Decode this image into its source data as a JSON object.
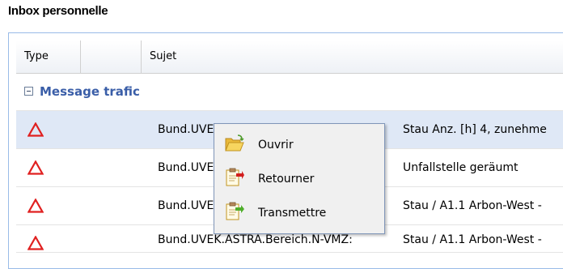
{
  "panel": {
    "title": "Inbox personnelle"
  },
  "grid": {
    "columns": [
      "Type",
      "",
      "Sujet"
    ],
    "group": {
      "label": "Message trafic",
      "state": "expanded"
    },
    "rows": [
      {
        "type_icon": "warning-triangle-icon",
        "from": "Bund.UVEK",
        "subject": "Stau Anz. [h] 4, zunehme",
        "selected": true
      },
      {
        "type_icon": "warning-triangle-icon",
        "from": "Bund.UVEK",
        "subject": "Unfallstelle geräumt",
        "selected": false
      },
      {
        "type_icon": "warning-triangle-icon",
        "from": "Bund.UVEK",
        "subject": "Stau / A1.1 Arbon-West -",
        "selected": false
      },
      {
        "type_icon": "warning-triangle-icon",
        "from": "Bund.UVEK.ASTRA.Bereich.N-VMZ:",
        "subject": "Stau / A1.1 Arbon-West -",
        "selected": false
      }
    ]
  },
  "context_menu": {
    "items": [
      {
        "label": "Ouvrir",
        "icon": "open-folder-icon"
      },
      {
        "label": "Retourner",
        "icon": "return-document-icon"
      },
      {
        "label": "Transmettre",
        "icon": "forward-document-icon"
      }
    ]
  },
  "colors": {
    "warning": "#e02020",
    "group_text": "#3a5ea8",
    "selection": "#dfe8f6",
    "border": "#99bbe8"
  }
}
